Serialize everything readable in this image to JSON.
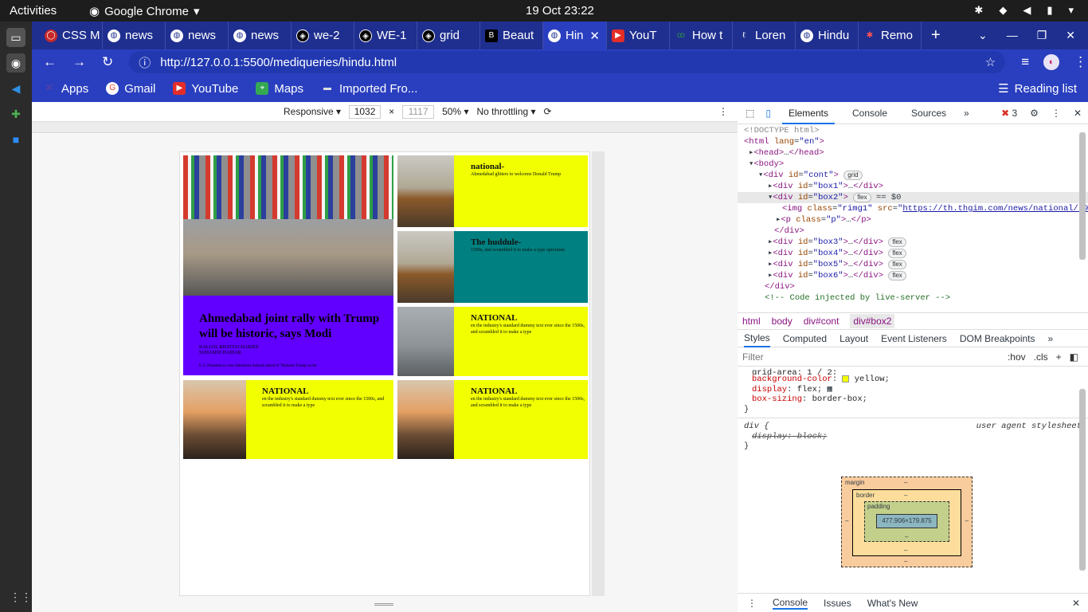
{
  "system": {
    "activities": "Activities",
    "app_name": "Google Chrome",
    "clock": "19 Oct  23:22"
  },
  "tabs": [
    {
      "label": "CSS M",
      "icon": "css-icon"
    },
    {
      "label": "news",
      "icon": "globe-icon"
    },
    {
      "label": "news",
      "icon": "globe-icon"
    },
    {
      "label": "news",
      "icon": "globe-icon"
    },
    {
      "label": "we-2",
      "icon": "codepen-icon"
    },
    {
      "label": "WE-1",
      "icon": "codepen-icon"
    },
    {
      "label": "grid",
      "icon": "codepen-icon"
    },
    {
      "label": "Beaut",
      "icon": "bookmark-icon"
    },
    {
      "label": "Hin",
      "icon": "globe-icon",
      "active": true
    },
    {
      "label": "YouT",
      "icon": "youtube-icon"
    },
    {
      "label": "How t",
      "icon": "gfg-icon"
    },
    {
      "label": "Loren",
      "icon": "lorem-icon"
    },
    {
      "label": "Hindu",
      "icon": "globe-icon"
    },
    {
      "label": "Remo",
      "icon": "remove-icon"
    }
  ],
  "omnibox": {
    "url": "http://127.0.0.1:5500/mediqueries/hindu.html"
  },
  "bookmarks": [
    {
      "label": "Apps",
      "icon": "apps-icon"
    },
    {
      "label": "Gmail",
      "icon": "google-icon"
    },
    {
      "label": "YouTube",
      "icon": "youtube-icon"
    },
    {
      "label": "Maps",
      "icon": "maps-icon"
    },
    {
      "label": "Imported Fro...",
      "icon": "folder-icon"
    }
  ],
  "reading_list": "Reading list",
  "device_toolbar": {
    "mode": "Responsive",
    "width": "1032",
    "times": "×",
    "height": "1117",
    "zoom": "50%",
    "throttle": "No throttling"
  },
  "page": {
    "box1": {
      "title": "Ahmedabad joint rally with Trump will be historic, says Modi",
      "author1": "KALLOL BHATTACHARJEE",
      "author2": "SUHASINI HAIDAR",
      "caption": "U.S. President to visit Sabarmati Ashram ahead of 'Namaste Trump' event"
    },
    "box2": {
      "heading": "national-",
      "text": "Ahmedabad glitters to welcome Donald Trump"
    },
    "box3": {
      "heading": "The huddule-",
      "text": "1500s, and scrambled it to make a type specimen"
    },
    "box4": {
      "heading": "NATIONAL",
      "text": "en the industry's standard dummy text ever since the 1500s, and scrambled it to make a type"
    },
    "box5": {
      "heading": "NATIONAL",
      "text": "en the industry's standard dummy text ever since the 1500s, and scrambled it to make a type"
    },
    "box6": {
      "heading": "NATIONAL",
      "text": "en the industry's standard dummy text ever since the 1500s, and scrambled it to make a type"
    }
  },
  "devtools": {
    "tabs": [
      "Elements",
      "Console",
      "Sources"
    ],
    "error_count": "3",
    "dom": {
      "doctype": "<!DOCTYPE html>",
      "img_src": "https://th.thgim.com/news/national/s9xcef/article30896383.ece/ALTERNATES/FREE_660/23THLTKASHMIRCLASSROOM",
      "code_injected": "Code injected by live-server"
    },
    "crumbs": [
      "html",
      "body",
      "div#cont",
      "div#box2"
    ],
    "style_tabs": [
      "Styles",
      "Computed",
      "Layout",
      "Event Listeners",
      "DOM Breakpoints"
    ],
    "filter_placeholder": "Filter",
    "hov": ":hov",
    "cls": ".cls",
    "css_rules": {
      "grid_area": "grid-area: 1 / 2;",
      "bg": "yellow",
      "display": "flex",
      "box_sizing": "border-box",
      "ua_label": "user agent stylesheet",
      "ua_display": "display: block;"
    },
    "box_model": {
      "margin": "margin",
      "border": "border",
      "padding": "padding",
      "content": "477.906×179.875",
      "dash": "–"
    },
    "console_tabs": [
      "Console",
      "Issues",
      "What's New"
    ]
  }
}
